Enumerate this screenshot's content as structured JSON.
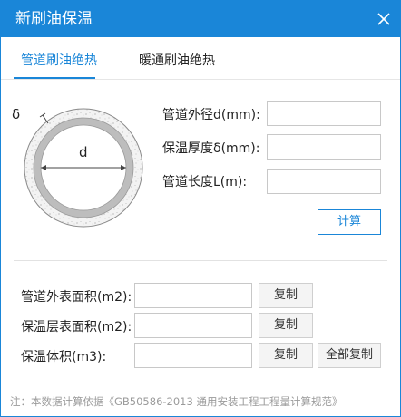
{
  "window": {
    "title": "新刷油保温"
  },
  "tabs": [
    {
      "label": "管道刷油绝热",
      "active": true
    },
    {
      "label": "暖通刷油绝热",
      "active": false
    }
  ],
  "diagram": {
    "delta_label": "δ",
    "d_label": "d"
  },
  "inputs": {
    "outer_diameter_label": "管道外径d(mm):",
    "insulation_thickness_label": "保温厚度δ(mm):",
    "pipe_length_label": "管道长度L(m):"
  },
  "calculate_label": "计算",
  "results": {
    "outer_surface_area_label": "管道外表面积(m2):",
    "insulation_surface_area_label": "保温层表面积(m2):",
    "insulation_volume_label": "保温体积(m3):"
  },
  "buttons": {
    "copy_label": "复制",
    "copy_all_label": "全部复制"
  },
  "note": "注：本数据计算依据《GB50586-2013 通用安装工程工程量计算规范》",
  "colors": {
    "accent": "#1a86d8"
  }
}
